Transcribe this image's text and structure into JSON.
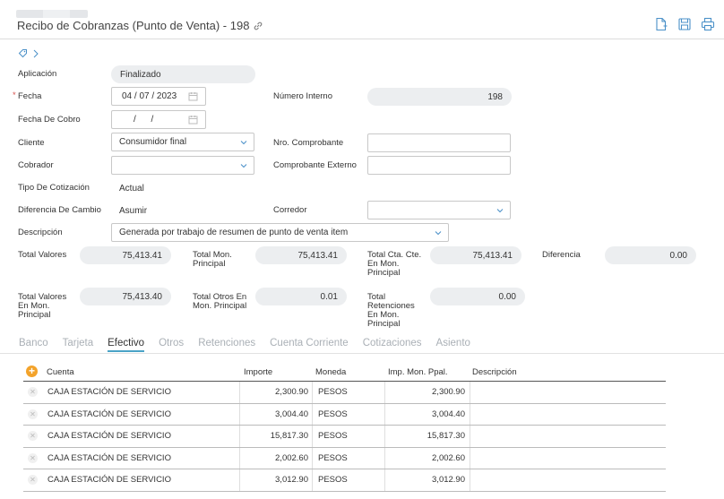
{
  "header": {
    "title": "Recibo de Cobranzas (Punto de Venta) - 198"
  },
  "form": {
    "aplicacion": {
      "label": "Aplicación",
      "value": "Finalizado"
    },
    "fecha": {
      "label": "Fecha",
      "value": "04 / 07 / 2023"
    },
    "fecha_cobro": {
      "label": "Fecha De Cobro",
      "value": "/      /"
    },
    "numero_interno": {
      "label": "Número Interno",
      "value": "198"
    },
    "cliente": {
      "label": "Cliente",
      "value": "Consumidor final"
    },
    "nro_comprobante": {
      "label": "Nro. Comprobante",
      "value": ""
    },
    "cobrador": {
      "label": "Cobrador",
      "value": ""
    },
    "comprobante_externo": {
      "label": "Comprobante Externo",
      "value": ""
    },
    "tipo_cotizacion": {
      "label": "Tipo De Cotización",
      "value": "Actual"
    },
    "diferencia_cambio": {
      "label": "Diferencia De Cambio",
      "value": "Asumir"
    },
    "corredor": {
      "label": "Corredor",
      "value": ""
    },
    "descripcion": {
      "label": "Descripción",
      "value": "Generada por trabajo de resumen de punto de venta item"
    }
  },
  "totals": {
    "total_valores": {
      "label": "Total Valores",
      "value": "75,413.41"
    },
    "total_mon_principal": {
      "label_1": "Total Mon.",
      "label_2": "Principal",
      "value": "75,413.41"
    },
    "total_cta_cte": {
      "label_1": "Total Cta. Cte.",
      "label_2": "En Mon.",
      "label_3": "Principal",
      "value": "75,413.41"
    },
    "diferencia": {
      "label": "Diferencia",
      "value": "0.00"
    },
    "total_valores_mon": {
      "label_1": "Total Valores",
      "label_2": "En Mon.",
      "label_3": "Principal",
      "value": "75,413.40"
    },
    "total_otros": {
      "label_1": "Total Otros En",
      "label_2": "Mon. Principal",
      "value": "0.01"
    },
    "total_retenciones": {
      "label_1": "Total",
      "label_2": "Retenciones",
      "label_3": "En Mon.",
      "label_4": "Principal",
      "value": "0.00"
    }
  },
  "tabs": [
    "Banco",
    "Tarjeta",
    "Efectivo",
    "Otros",
    "Retenciones",
    "Cuenta Corriente",
    "Cotizaciones",
    "Asiento"
  ],
  "grid": {
    "headers": {
      "cuenta": "Cuenta",
      "importe": "Importe",
      "moneda": "Moneda",
      "imp_mon": "Imp. Mon. Ppal.",
      "descripcion": "Descripción"
    },
    "rows": [
      {
        "cuenta": "CAJA ESTACIÓN DE SERVICIO",
        "importe": "2,300.90",
        "moneda": "PESOS",
        "imp_mon": "2,300.90"
      },
      {
        "cuenta": "CAJA ESTACIÓN DE SERVICIO",
        "importe": "3,004.40",
        "moneda": "PESOS",
        "imp_mon": "3,004.40"
      },
      {
        "cuenta": "CAJA ESTACIÓN DE SERVICIO",
        "importe": "15,817.30",
        "moneda": "PESOS",
        "imp_mon": "15,817.30"
      },
      {
        "cuenta": "CAJA ESTACIÓN DE SERVICIO",
        "importe": "2,002.60",
        "moneda": "PESOS",
        "imp_mon": "2,002.60"
      },
      {
        "cuenta": "CAJA ESTACIÓN DE SERVICIO",
        "importe": "3,012.90",
        "moneda": "PESOS",
        "imp_mon": "3,012.90"
      }
    ]
  },
  "colors": {
    "accent": "#4a90c8",
    "tab_underline": "#4aa3c7",
    "add_button": "#f3a32b",
    "required": "#d9534f"
  }
}
